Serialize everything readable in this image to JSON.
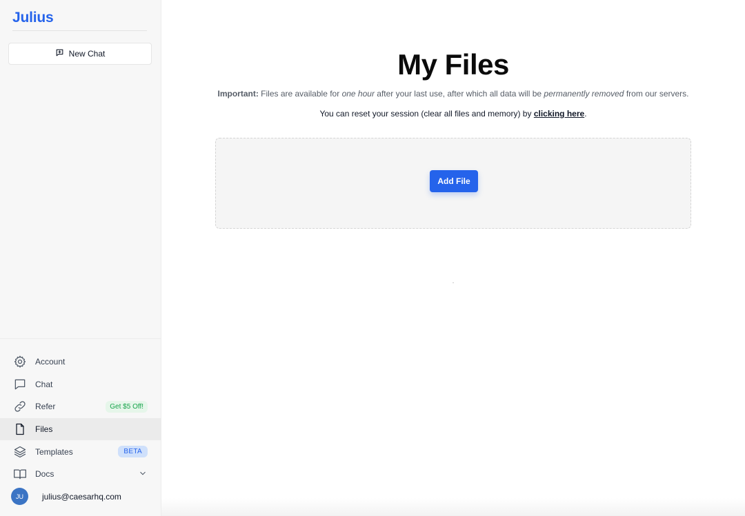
{
  "sidebar": {
    "brand": "Julius",
    "new_chat_label": "New Chat",
    "nav": [
      {
        "label": "Account",
        "icon": "gear-icon"
      },
      {
        "label": "Chat",
        "icon": "chat-bubble-icon"
      },
      {
        "label": "Refer",
        "icon": "link-icon",
        "badge": "Get $5 Off!"
      },
      {
        "label": "Files",
        "icon": "file-icon",
        "active": true
      },
      {
        "label": "Templates",
        "icon": "layers-icon",
        "badge": "BETA"
      },
      {
        "label": "Docs",
        "icon": "book-icon"
      }
    ],
    "user": {
      "initials": "JU",
      "email": "julius@caesarhq.com"
    }
  },
  "main": {
    "title": "My Files",
    "important_label": "Important:",
    "important_text_1": "Files are available for",
    "important_em_1": "one hour",
    "important_text_2": "after your last use, after which all data will be",
    "important_em_2": "permanently removed",
    "important_text_3": "from our servers.",
    "reset_text": "You can reset your session (clear all files and memory) by",
    "reset_link": "clicking here",
    "reset_end": ".",
    "add_file_label": "Add File"
  },
  "colors": {
    "accent": "#2563eb",
    "refer_badge": "#16a34a",
    "beta_badge": "#2563eb"
  }
}
